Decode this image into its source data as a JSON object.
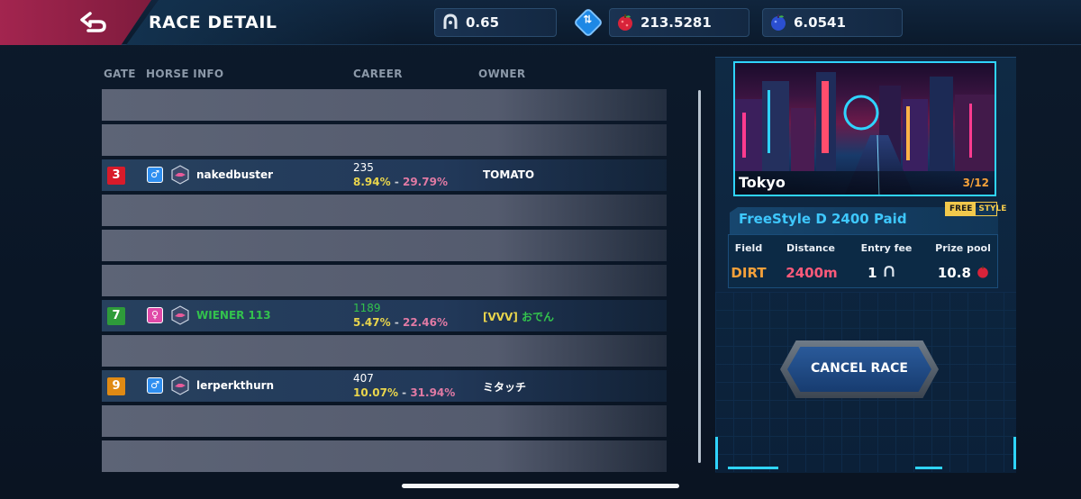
{
  "header": {
    "title": "RACE DETAIL",
    "horseshoe_value": "0.65",
    "apple_value": "213.5281",
    "blueberry_value": "6.0541"
  },
  "columns": {
    "gate": "GATE",
    "horse_info": "HORSE INFO",
    "career": "CAREER",
    "owner": "OWNER"
  },
  "entries": [
    {
      "filled": false
    },
    {
      "filled": false
    },
    {
      "filled": true,
      "gate": "3",
      "gate_color": "#d81b2a",
      "sex": "♂",
      "sex_color": "#2f8ff0",
      "name": "nakedbuster",
      "name_color": "#ffffff",
      "races": "235",
      "races_color": "#ffffff",
      "pct_win": "8.94%",
      "sep": " - ",
      "pct_place": "29.79%",
      "owner": "TOMATO",
      "owner_color": "#ffffff",
      "owner_prefix": ""
    },
    {
      "filled": false
    },
    {
      "filled": false
    },
    {
      "filled": false
    },
    {
      "filled": true,
      "gate": "7",
      "gate_color": "#2e9b3a",
      "sex": "♀",
      "sex_color": "#e04aa8",
      "name": "WIENER 113",
      "name_color": "#33c24d",
      "races": "1189",
      "races_color": "#33c24d",
      "pct_win": "5.47%",
      "sep": " - ",
      "pct_place": "22.46%",
      "owner": "おでん",
      "owner_color": "#33c24d",
      "owner_prefix": "[VVV] "
    },
    {
      "filled": false
    },
    {
      "filled": true,
      "gate": "9",
      "gate_color": "#e08a14",
      "sex": "♂",
      "sex_color": "#2f8ff0",
      "name": "lerperkthurn",
      "name_color": "#ffffff",
      "races": "407",
      "races_color": "#ffffff",
      "pct_win": "10.07%",
      "sep": " - ",
      "pct_place": "31.94%",
      "owner": "ミタッチ",
      "owner_color": "#ffffff",
      "owner_prefix": ""
    },
    {
      "filled": false
    },
    {
      "filled": false
    }
  ],
  "race": {
    "city": "Tokyo",
    "count": "3/12",
    "name": "FreeStyle D 2400 Paid",
    "badge_a": "FREE",
    "badge_b": "STYLE",
    "labels": {
      "field": "Field",
      "distance": "Distance",
      "entry_fee": "Entry fee",
      "prize_pool": "Prize pool"
    },
    "values": {
      "field": "DIRT",
      "distance": "2400m",
      "entry_fee": "1",
      "prize_pool": "10.8"
    },
    "field_color": "#f5a13a",
    "distance_color": "#ff5a7a"
  },
  "buttons": {
    "cancel": "CANCEL RACE"
  },
  "icons": {
    "back": "back-arrow-icon",
    "horseshoe": "horseshoe-icon",
    "swap": "swap-icon",
    "apple": "apple-icon",
    "blueberry": "blueberry-icon"
  }
}
